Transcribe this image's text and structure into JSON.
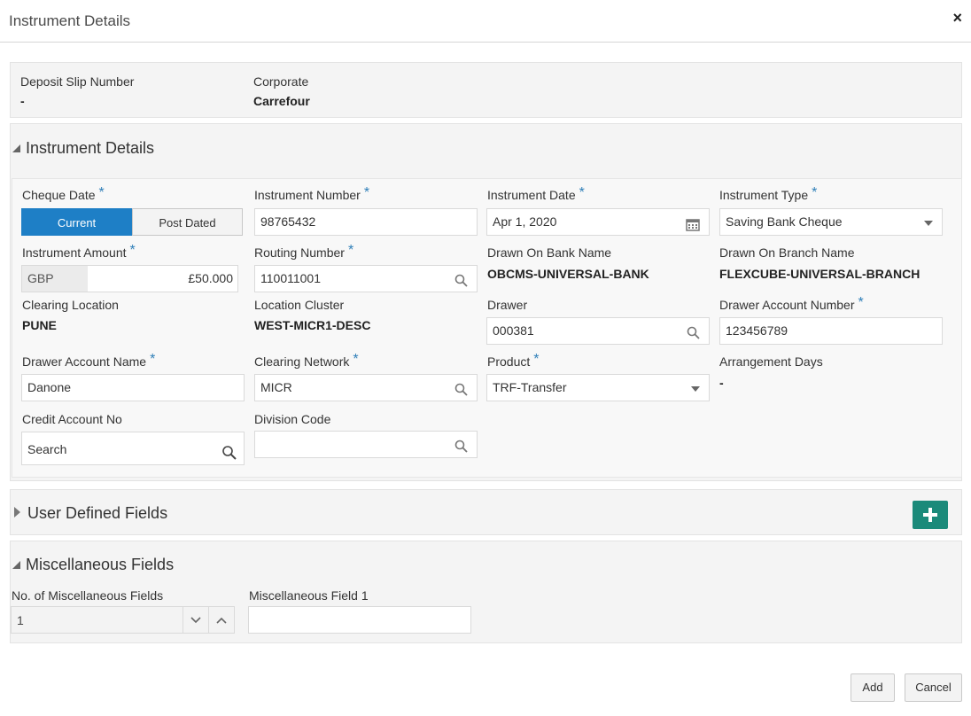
{
  "dialog": {
    "title": "Instrument Details",
    "close_symbol": "×"
  },
  "summary": {
    "deposit_slip_label": "Deposit Slip Number",
    "deposit_slip_value": "-",
    "corporate_label": "Corporate",
    "corporate_value": "Carrefour"
  },
  "instrument_section": {
    "title": "Instrument Details",
    "cheque_date": {
      "label": "Cheque Date",
      "options": [
        "Current",
        "Post Dated"
      ],
      "selected": "Current"
    },
    "instrument_number": {
      "label": "Instrument Number",
      "value": "98765432"
    },
    "instrument_date": {
      "label": "Instrument Date",
      "value": "Apr 1, 2020"
    },
    "instrument_type": {
      "label": "Instrument Type",
      "value": "Saving Bank Cheque"
    },
    "instrument_amount": {
      "label": "Instrument Amount",
      "currency": "GBP",
      "value": "£50.000"
    },
    "routing_number": {
      "label": "Routing Number",
      "value": "110011001"
    },
    "drawn_on_bank_name": {
      "label": "Drawn On Bank Name",
      "value": "OBCMS-UNIVERSAL-BANK"
    },
    "drawn_on_branch_name": {
      "label": "Drawn On Branch Name",
      "value": "FLEXCUBE-UNIVERSAL-BRANCH"
    },
    "clearing_location": {
      "label": "Clearing Location",
      "value": "PUNE"
    },
    "location_cluster": {
      "label": "Location Cluster",
      "value": "WEST-MICR1-DESC"
    },
    "drawer": {
      "label": "Drawer",
      "value": "000381"
    },
    "drawer_account_number": {
      "label": "Drawer Account Number",
      "value": "123456789"
    },
    "drawer_account_name": {
      "label": "Drawer Account Name",
      "value": "Danone"
    },
    "clearing_network": {
      "label": "Clearing Network",
      "value": "MICR"
    },
    "product": {
      "label": "Product",
      "value": "TRF-Transfer"
    },
    "arrangement_days": {
      "label": "Arrangement Days",
      "value": "-"
    },
    "credit_account_no": {
      "label": "Credit Account No",
      "placeholder": "Search"
    },
    "division_code": {
      "label": "Division Code",
      "value": ""
    },
    "required_marker": "*"
  },
  "udf_section": {
    "title": "User Defined Fields"
  },
  "misc_section": {
    "title": "Miscellaneous Fields",
    "count_label": "No. of Miscellaneous Fields",
    "count_value": "1",
    "field1_label": "Miscellaneous Field 1",
    "field1_value": ""
  },
  "footer": {
    "add_label": "Add",
    "cancel_label": "Cancel"
  },
  "colors": {
    "accent": "#1e7fc6",
    "add_button": "#1b8a7a",
    "required": "#2f7fb8"
  }
}
